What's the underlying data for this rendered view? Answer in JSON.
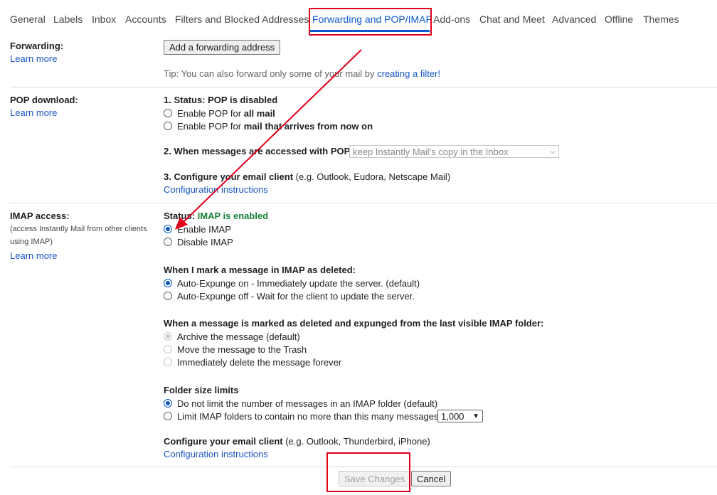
{
  "tabs": [
    {
      "label": "General"
    },
    {
      "label": "Labels"
    },
    {
      "label": "Inbox"
    },
    {
      "label": "Accounts"
    },
    {
      "label": "Filters and Blocked Addresses"
    },
    {
      "label": "Forwarding and POP/IMAP"
    },
    {
      "label": "Add-ons"
    },
    {
      "label": "Chat and Meet"
    },
    {
      "label": "Advanced"
    },
    {
      "label": "Offline"
    },
    {
      "label": "Themes"
    }
  ],
  "forwarding": {
    "label": "Forwarding:",
    "learn_more": "Learn more",
    "add_button": "Add a forwarding address",
    "tip_prefix": "Tip: You can also forward only some of your mail by ",
    "tip_link": "creating a filter!"
  },
  "pop": {
    "label": "POP download:",
    "learn_more": "Learn more",
    "status_prefix": "1. Status: ",
    "status_value": "POP is disabled",
    "opt1_prefix": "Enable POP for ",
    "opt1_bold": "all mail",
    "opt2_prefix": "Enable POP for ",
    "opt2_bold": "mail that arrives from now on",
    "when_label": "2. When messages are accessed with POP",
    "when_select": "keep Instantly Mail's copy in the Inbox",
    "configure_bold": "3. Configure your email client",
    "configure_rest": " (e.g. Outlook, Eudora, Netscape Mail)",
    "config_link": "Configuration instructions"
  },
  "imap": {
    "label": "IMAP access:",
    "note": "(access Instantly Mail from other clients using IMAP)",
    "learn_more": "Learn more",
    "status_prefix": "Status: ",
    "status_value": "IMAP is enabled",
    "enable": "Enable IMAP",
    "disable": "Disable IMAP",
    "deleted_heading": "When I mark a message in IMAP as deleted:",
    "expunge_on": "Auto-Expunge on - Immediately update the server. (default)",
    "expunge_off": "Auto-Expunge off - Wait for the client to update the server.",
    "expunged_heading": "When a message is marked as deleted and expunged from the last visible IMAP folder:",
    "archive": "Archive the message (default)",
    "trash": "Move the message to the Trash",
    "delete_forever": "Immediately delete the message forever",
    "folder_heading": "Folder size limits",
    "no_limit": "Do not limit the number of messages in an IMAP folder (default)",
    "limit": "Limit IMAP folders to contain no more than this many messages",
    "limit_value": "1,000",
    "configure_bold": "Configure your email client",
    "configure_rest": " (e.g. Outlook, Thunderbird, iPhone)",
    "config_link": "Configuration instructions"
  },
  "footer": {
    "save": "Save Changes",
    "cancel": "Cancel"
  },
  "colors": {
    "accent": "#0b57d0",
    "annotation": "#e0001b",
    "enabled_status": "#188038",
    "link": "#1a55c4"
  }
}
